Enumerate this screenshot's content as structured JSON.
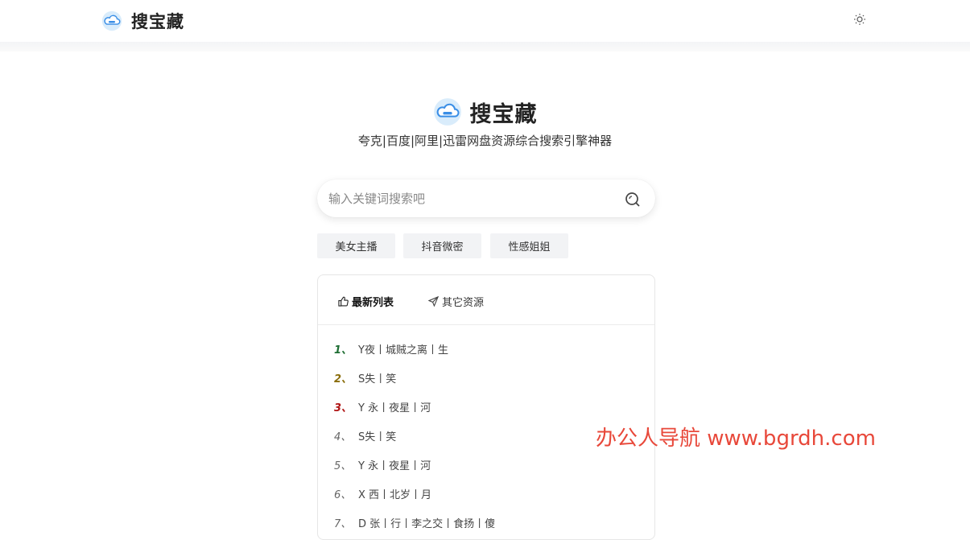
{
  "header": {
    "brand": "搜宝藏",
    "logo_icon": "cloud-logo-icon",
    "theme_icon": "sun-icon"
  },
  "hero": {
    "title": "搜宝藏",
    "tagline": "夸克|百度|阿里|迅雷网盘资源综合搜索引擎神器"
  },
  "search": {
    "placeholder": "输入关键词搜索吧",
    "value": "",
    "icon": "search-icon"
  },
  "tags": [
    "美女主播",
    "抖音微密",
    "性感姐姐"
  ],
  "panel": {
    "tabs": [
      {
        "label": "最新列表",
        "icon": "thumbs-up-icon",
        "active": true
      },
      {
        "label": "其它资源",
        "icon": "send-icon",
        "active": false
      }
    ],
    "items": [
      {
        "rank": "1、",
        "title": "Y夜丨城贼之离丨生",
        "rank_color": "#1e6e33"
      },
      {
        "rank": "2、",
        "title": "S失丨笑",
        "rank_color": "#8a6d0b"
      },
      {
        "rank": "3、",
        "title": "Y 永丨夜星丨河",
        "rank_color": "#b01515"
      },
      {
        "rank": "4、",
        "title": "S失丨笑",
        "rank_color": "#666666"
      },
      {
        "rank": "5、",
        "title": "Y 永丨夜星丨河",
        "rank_color": "#666666"
      },
      {
        "rank": "6、",
        "title": "X 西丨北岁丨月",
        "rank_color": "#666666"
      },
      {
        "rank": "7、",
        "title": "D 张丨行丨李之交丨食扬丨傻",
        "rank_color": "#666666"
      }
    ]
  },
  "watermark": "办公人导航 www.bgrdh.com",
  "colors": {
    "accent_blue": "#3a8ee6",
    "watermark_red": "#e8483a"
  }
}
